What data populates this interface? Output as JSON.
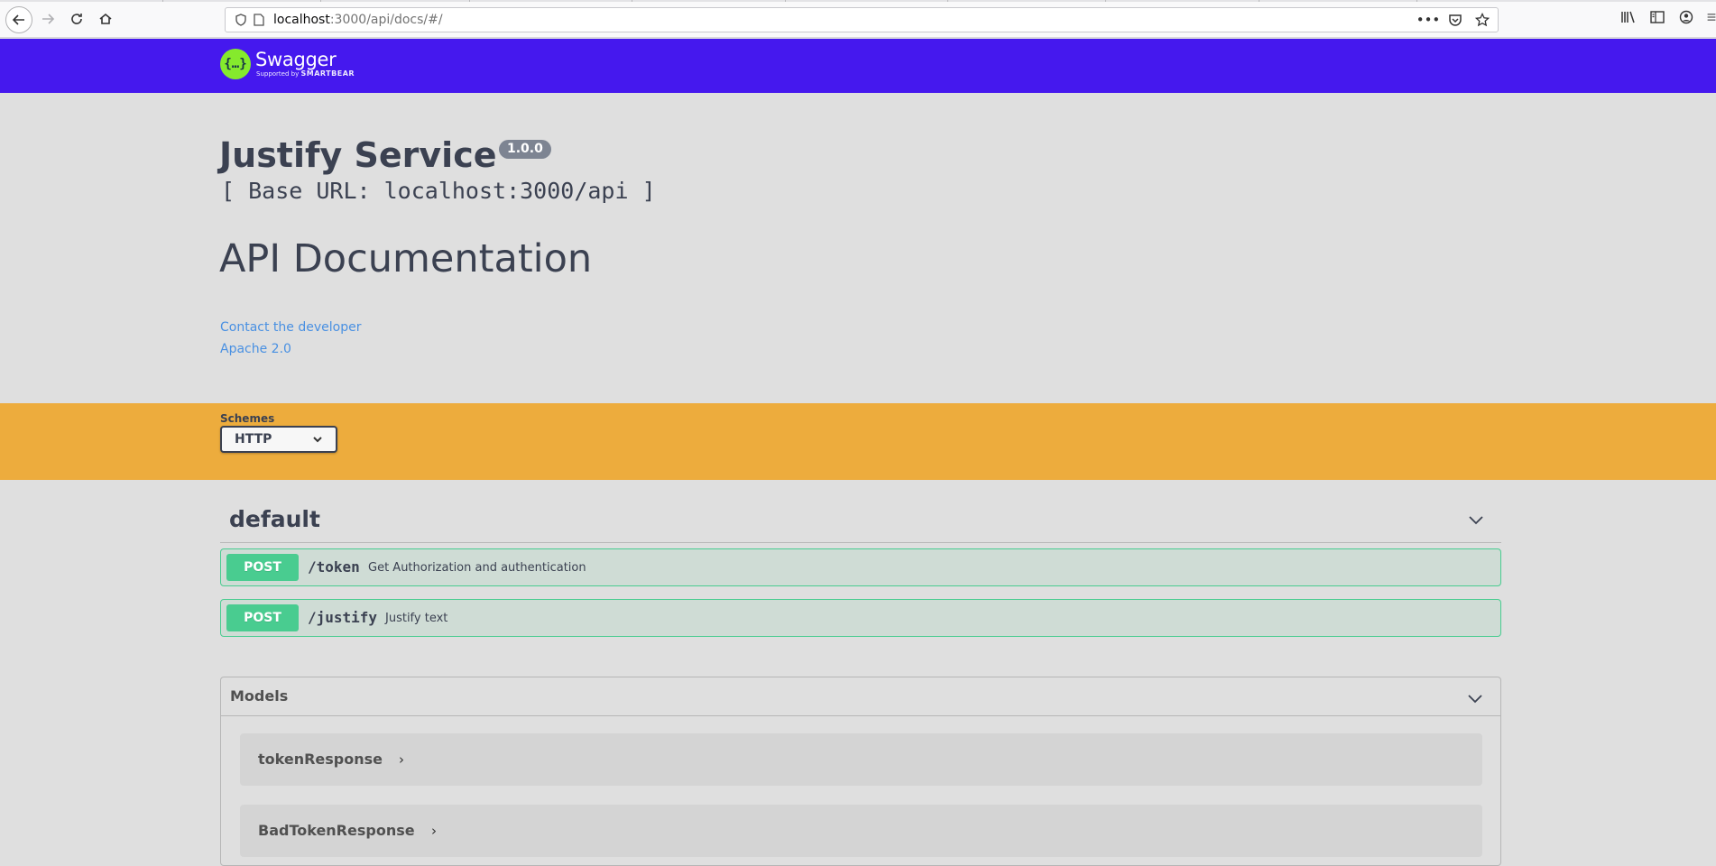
{
  "browser": {
    "url_host": "localhost",
    "url_rest": ":3000/api/docs/#/"
  },
  "topbar": {
    "logo_name": "Swagger",
    "logo_supported_by": "Supported by",
    "logo_smartbear": "SMARTBEAR",
    "logo_symbol": "{…}",
    "background_color": "#4518ee"
  },
  "info": {
    "title": "Justify Service",
    "version": "1.0.0",
    "base_url": "[ Base URL: localhost:3000/api ]",
    "description": "API Documentation",
    "contact_link": "Contact the developer",
    "license_link": "Apache 2.0"
  },
  "schemes": {
    "label": "Schemes",
    "selected": "HTTP",
    "background_color": "#edac3d"
  },
  "operations": {
    "tag": "default",
    "items": [
      {
        "method": "POST",
        "path": "/token",
        "summary": "Get Authorization and authentication"
      },
      {
        "method": "POST",
        "path": "/justify",
        "summary": "Justify text"
      }
    ],
    "post_color": "#49cc90"
  },
  "models": {
    "title": "Models",
    "items": [
      {
        "name": "tokenResponse",
        "toggle": "›"
      },
      {
        "name": "BadTokenResponse",
        "toggle": "›"
      }
    ]
  }
}
